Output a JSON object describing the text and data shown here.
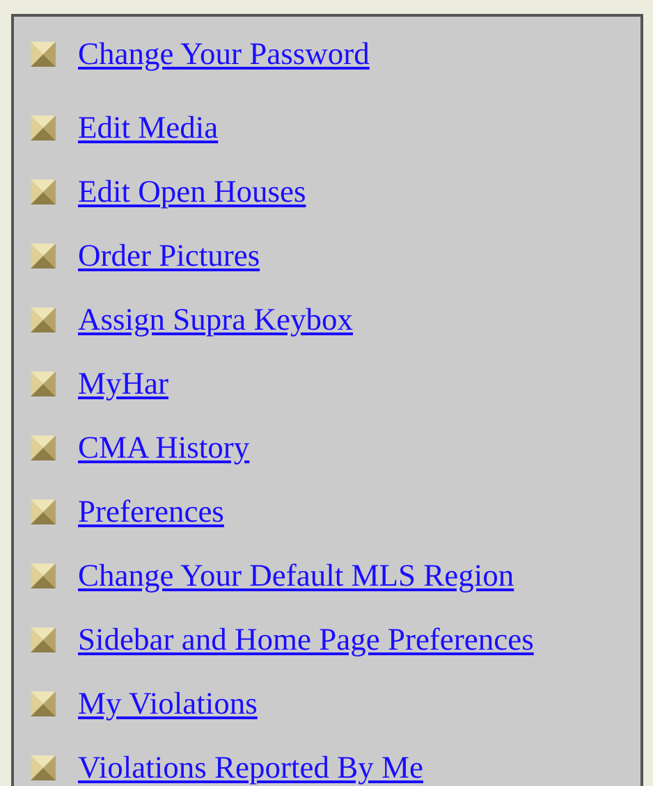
{
  "links": [
    {
      "label": "Change Your Password"
    },
    {
      "label": "Edit Media"
    },
    {
      "label": "Edit Open Houses"
    },
    {
      "label": "Order Pictures"
    },
    {
      "label": "Assign Supra Keybox"
    },
    {
      "label": "MyHar"
    },
    {
      "label": "CMA History"
    },
    {
      "label": "Preferences"
    },
    {
      "label": "Change Your Default MLS Region"
    },
    {
      "label": "Sidebar and Home Page Preferences"
    },
    {
      "label": "My Violations"
    },
    {
      "label": "Violations Reported By Me"
    }
  ]
}
